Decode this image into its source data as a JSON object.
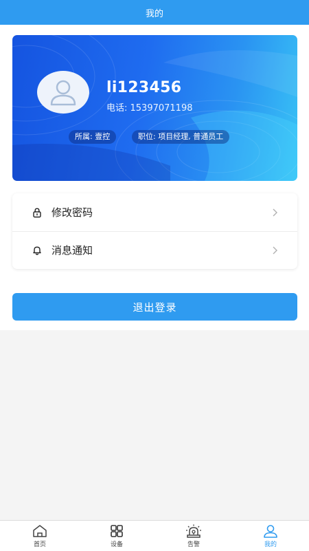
{
  "header": {
    "title": "我的"
  },
  "profile": {
    "username": "li123456",
    "phone": "电话: 15397071198",
    "org": "所属: 壹控",
    "position": "职位: 项目经理, 普通员工"
  },
  "menu": {
    "items": [
      {
        "label": "修改密码",
        "icon": "lock-icon"
      },
      {
        "label": "消息通知",
        "icon": "bell-icon"
      }
    ]
  },
  "logout": {
    "label": "退出登录"
  },
  "tabbar": {
    "items": [
      {
        "label": "首页",
        "icon": "home-icon"
      },
      {
        "label": "设备",
        "icon": "grid-icon"
      },
      {
        "label": "告警",
        "icon": "alarm-icon"
      },
      {
        "label": "我的",
        "icon": "user-icon",
        "active": true
      }
    ]
  },
  "colors": {
    "accent": "#2f9bf0",
    "card_gradient_start": "#1554e0",
    "card_gradient_end": "#39c3f5",
    "background": "#f4f4f4"
  }
}
